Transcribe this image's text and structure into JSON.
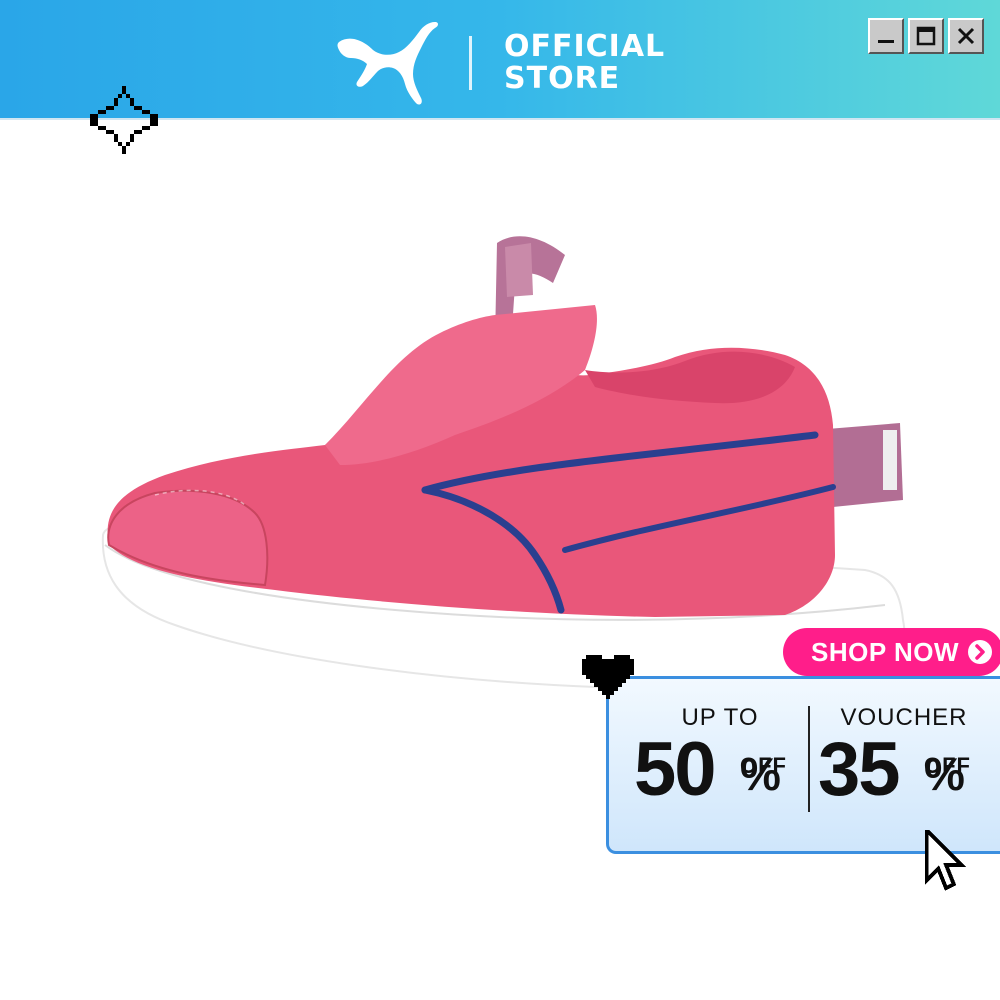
{
  "header": {
    "brand_line1": "OFFICIAL",
    "brand_line2": "STORE",
    "logo_icon": "puma-cat-logo-icon",
    "gradient_colors": [
      "#2aa6e8",
      "#5fd8d8"
    ]
  },
  "window_controls": [
    "minimize-icon",
    "maximize-icon",
    "close-icon"
  ],
  "product": {
    "image": "pink-slip-on-sneaker",
    "colors": {
      "upper": "#e9577a",
      "stripe": "#2a3f8f",
      "sole": "#ffffff",
      "heel_tab": "#b26e94"
    }
  },
  "shop_now": {
    "label": "SHOP NOW",
    "color": "#ff1e8a"
  },
  "offer": {
    "left": {
      "label": "UP TO",
      "value": "50",
      "percent": "%",
      "suffix": "OFF"
    },
    "right": {
      "label": "VOUCHER",
      "value": "35",
      "percent": "%",
      "suffix": "OFF"
    },
    "border_color": "#3b8fe0"
  },
  "decorations": [
    "sparkle-icon",
    "pixel-heart-icon",
    "pixel-cursor-icon"
  ]
}
